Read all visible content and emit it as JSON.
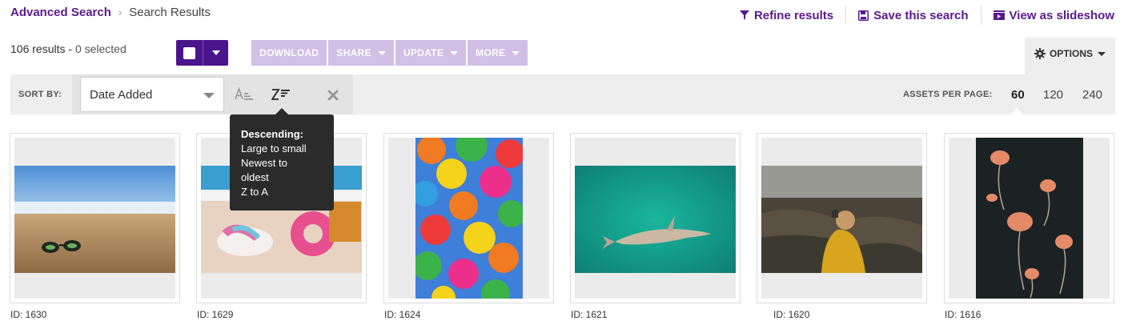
{
  "breadcrumb": {
    "parent": "Advanced Search",
    "current": "Search Results"
  },
  "top_actions": [
    {
      "label": "Refine results",
      "icon": "funnel-icon"
    },
    {
      "label": "Save this search",
      "icon": "floppy-disk-icon"
    },
    {
      "label": "View as slideshow",
      "icon": "slideshow-icon"
    }
  ],
  "results": {
    "count": "106 results -",
    "selected": "0 selected"
  },
  "toolbar": {
    "download": "DOWNLOAD",
    "share": "SHARE",
    "update": "UPDATE",
    "more": "MORE",
    "options": "OPTIONS"
  },
  "sort": {
    "label": "SORT BY:",
    "value": "Date Added",
    "ascending_icon": "sort-ascending-icon",
    "descending_icon": "sort-descending-icon",
    "clear_icon": "close-icon"
  },
  "per_page": {
    "label": "ASSETS PER PAGE:",
    "options": [
      "60",
      "120",
      "240"
    ],
    "selected": "60"
  },
  "tooltip": {
    "title": "Descending:",
    "lines": [
      "Large to small",
      "Newest to",
      "oldest",
      "Z to A"
    ]
  },
  "assets": [
    {
      "id": "ID: 1630",
      "subject": "sunglasses on beach"
    },
    {
      "id": "ID: 1629",
      "subject": "flamingo float on beach"
    },
    {
      "id": "ID: 1624",
      "subject": "colorful umbrellas"
    },
    {
      "id": "ID: 1621",
      "subject": "shark in teal water"
    },
    {
      "id": "ID: 1620",
      "subject": "woman on rocky coast"
    },
    {
      "id": "ID: 1616",
      "subject": "jellyfish"
    }
  ],
  "colors": {
    "brand": "#4b148c",
    "link": "#5a1a8f",
    "disabled_button": "#d1bfe6"
  }
}
